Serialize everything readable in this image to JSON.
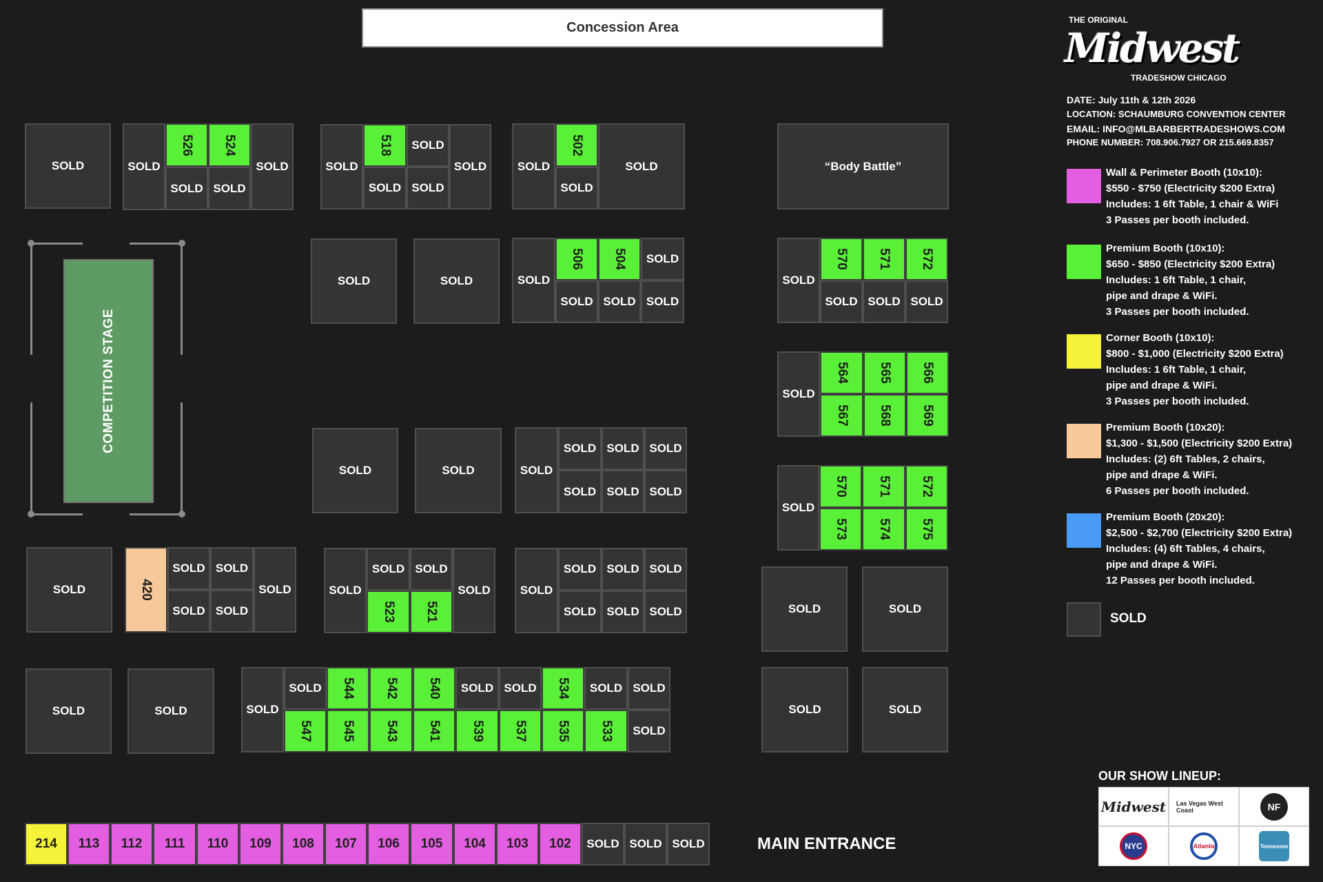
{
  "header": {
    "concession": "Concession Area"
  },
  "stage": {
    "label": "COMPETITION STAGE"
  },
  "body_battle": "“Body Battle”",
  "main_entrance": "MAIN ENTRANCE",
  "booth_sold": "SOLD",
  "branding": {
    "top": "THE ORIGINAL",
    "script": "Midwest",
    "bottom": "TRADESHOW CHICAGO"
  },
  "event": {
    "date": "DATE: July 11th & 12th 2026",
    "location": "LOCATION: SCHAUMBURG CONVENTION CENTER",
    "email": "EMAIL: INFO@MLBARBERTRADESHOWS.COM",
    "phone": "PHONE NUMBER: 708.906.7927 OR 215.669.8357"
  },
  "legend": [
    {
      "key": "wall",
      "color": "#e35ee0",
      "lines": [
        "Wall & Perimeter Booth (10x10):",
        "$550 - $750 (Electricity $200 Extra)",
        "Includes: 1 6ft Table, 1 chair & WiFi",
        "3 Passes per booth included."
      ]
    },
    {
      "key": "premium",
      "color": "#5af037",
      "lines": [
        "Premium Booth (10x10):",
        "$650 - $850 (Electricity $200 Extra)",
        "Includes: 1 6ft Table, 1 chair,",
        "pipe and drape & WiFi.",
        "3 Passes per booth included."
      ]
    },
    {
      "key": "corner",
      "color": "#f5f23a",
      "lines": [
        "Corner Booth (10x10):",
        "$800 - $1,000 (Electricity $200 Extra)",
        "Includes: 1 6ft Table, 1 chair,",
        "pipe and drape & WiFi.",
        "3 Passes per booth included."
      ]
    },
    {
      "key": "premium20",
      "color": "#f7c89a",
      "lines": [
        "Premium Booth (10x20):",
        "$1,300 - $1,500 (Electricity $200 Extra)",
        "Includes: (2) 6ft Tables, 2 chairs,",
        "pipe and drape & WiFi.",
        "6 Passes per booth included."
      ]
    },
    {
      "key": "premium2020",
      "color": "#4a9bf5",
      "lines": [
        "Premium Booth (20x20):",
        "$2,500 - $2,700 (Electricity $200 Extra)",
        "Includes: (4) 6ft Tables, 4 chairs,",
        "pipe and drape & WiFi.",
        "12 Passes per booth included."
      ]
    },
    {
      "key": "sold",
      "color": "#343434",
      "lines": [
        "SOLD"
      ]
    }
  ],
  "lineup": {
    "title": "OUR SHOW LINEUP:",
    "logos": [
      "Midwest",
      "Las Vegas West Coast",
      "NF",
      "NYC",
      "Atlanta",
      "Tennessee"
    ]
  },
  "booths": {
    "526": "526",
    "524": "524",
    "518": "518",
    "502": "502",
    "506": "506",
    "504": "504",
    "570": "570",
    "571": "571",
    "572": "572",
    "564": "564",
    "565": "565",
    "566": "566",
    "567": "567",
    "568": "568",
    "569": "569",
    "573": "573",
    "574": "574",
    "575": "575",
    "420": "420",
    "523": "523",
    "521": "521",
    "544": "544",
    "542": "542",
    "540": "540",
    "534": "534",
    "547": "547",
    "545": "545",
    "543": "543",
    "541": "541",
    "539": "539",
    "537": "537",
    "535": "535",
    "533": "533",
    "214": "214",
    "113": "113",
    "112": "112",
    "111": "111",
    "110": "110",
    "109": "109",
    "108": "108",
    "107": "107",
    "106": "106",
    "105": "105",
    "104": "104",
    "103": "103",
    "102": "102"
  }
}
